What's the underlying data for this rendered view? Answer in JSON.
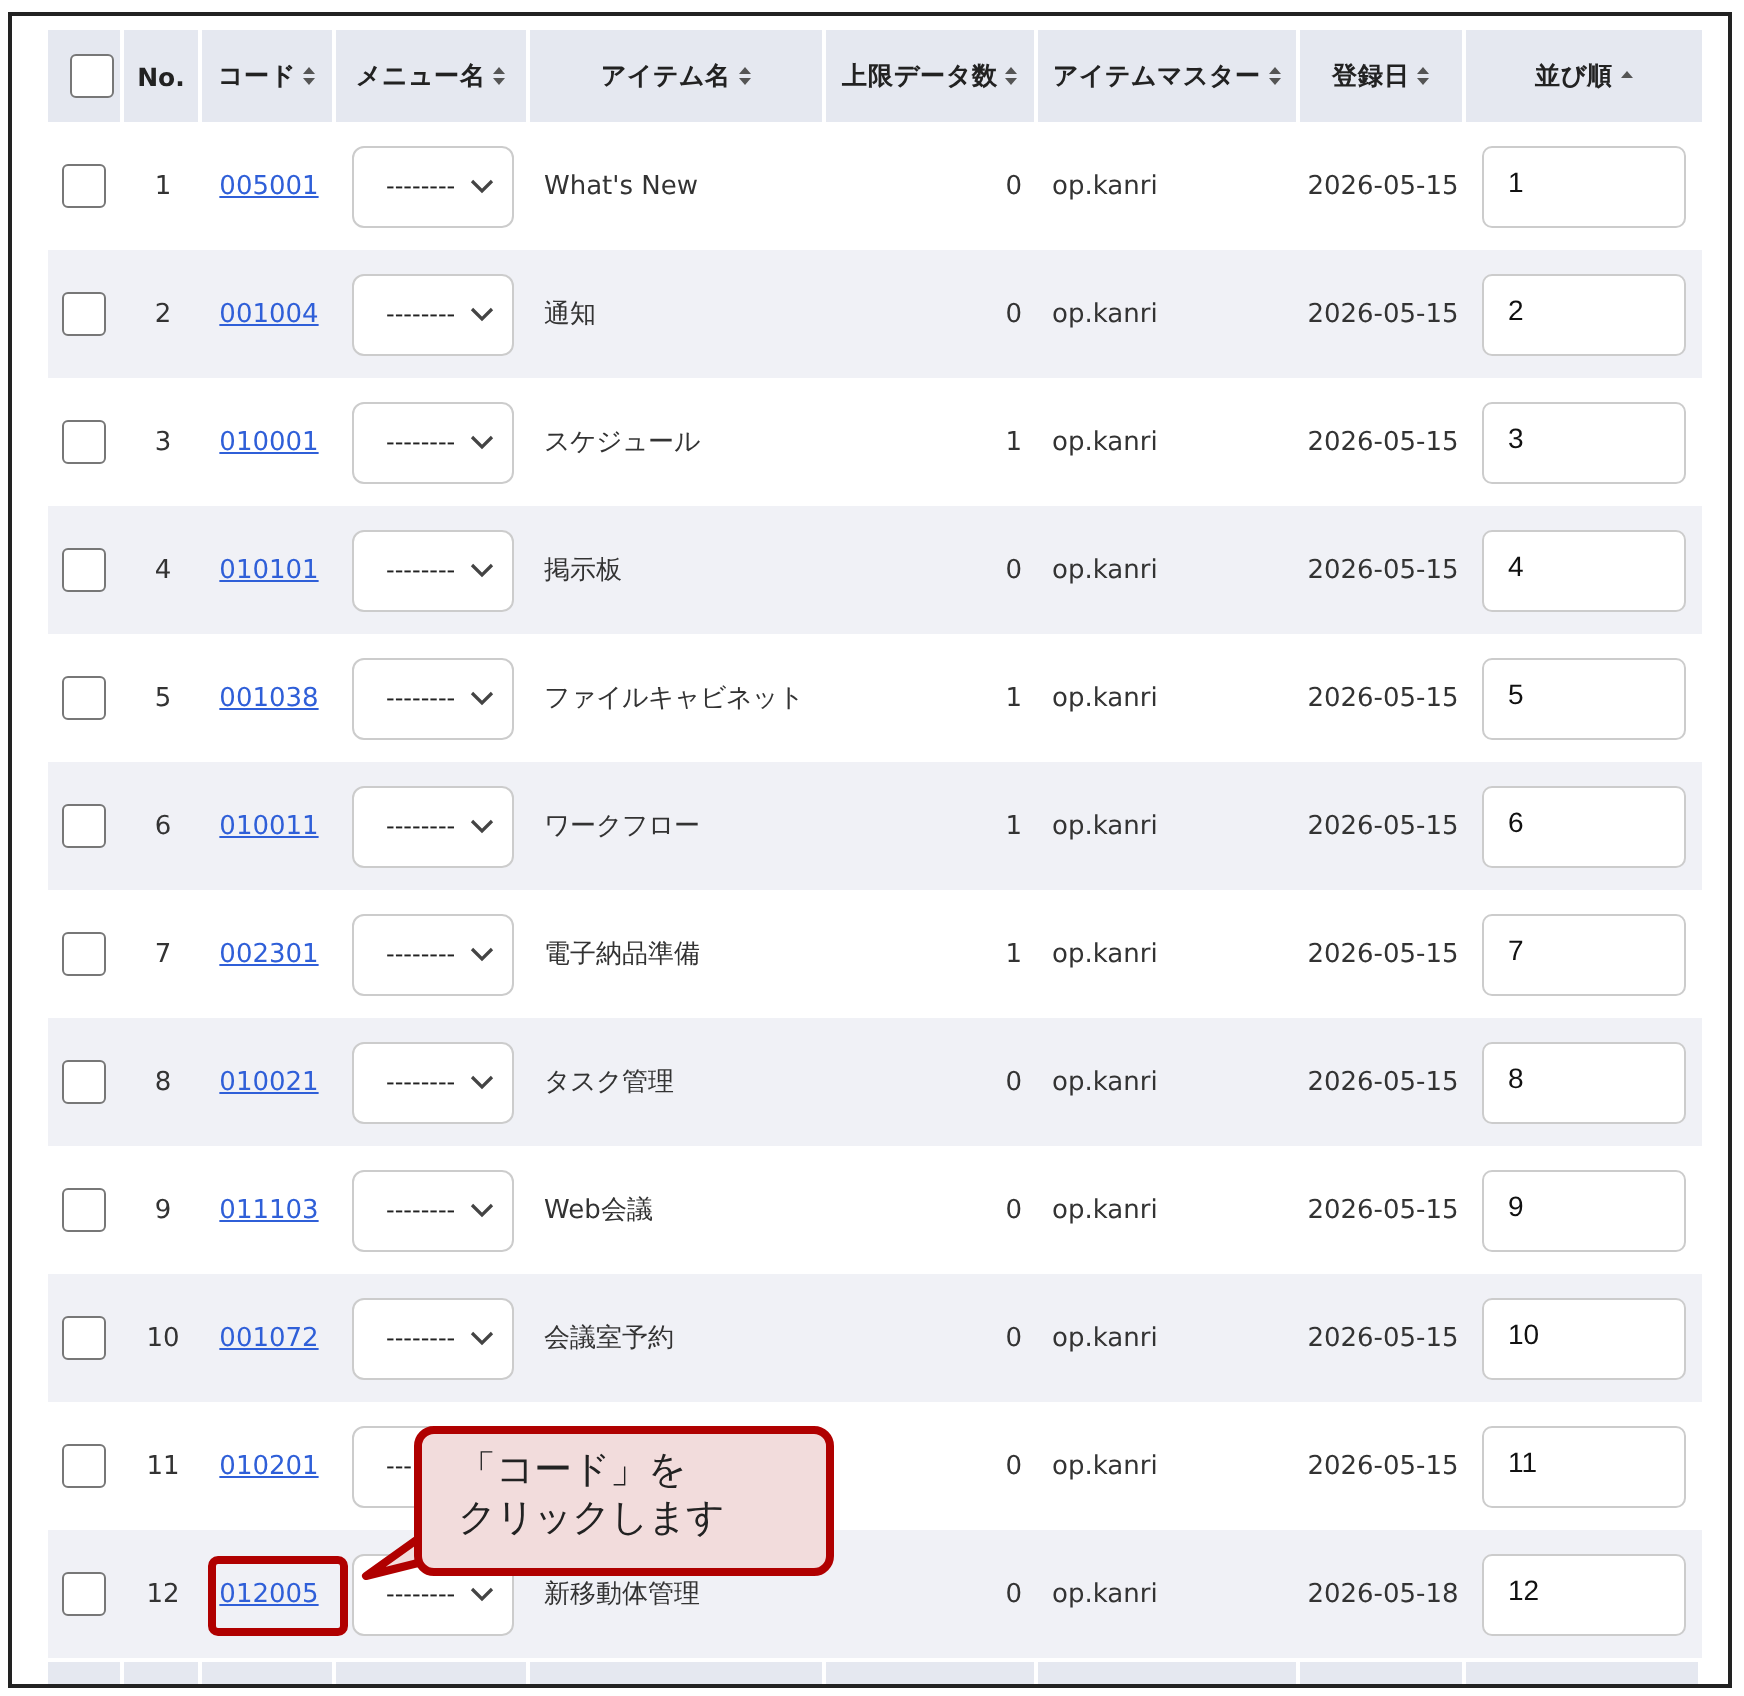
{
  "table": {
    "columns": [
      {
        "kind": "checkbox",
        "checked": false
      },
      {
        "kind": "text",
        "label": "No.",
        "sortable": false
      },
      {
        "kind": "text",
        "label": "コード",
        "sortable": true,
        "sorted": false
      },
      {
        "kind": "text",
        "label": "メニュー名",
        "sortable": true,
        "sorted": false
      },
      {
        "kind": "text",
        "label": "アイテム名",
        "sortable": true,
        "sorted": false
      },
      {
        "kind": "text",
        "label": "上限データ数",
        "sortable": true,
        "sorted": false
      },
      {
        "kind": "text",
        "label": "アイテムマスター",
        "sortable": true,
        "sorted": false
      },
      {
        "kind": "text",
        "label": "登録日",
        "sortable": true,
        "sorted": false
      },
      {
        "kind": "text",
        "label": "並び順",
        "sortable": true,
        "sorted": true
      }
    ],
    "rows": [
      {
        "checked": false,
        "no": "1",
        "code": "005001",
        "menu": "--------",
        "item": "What's New",
        "limit": "0",
        "master": "op.kanri",
        "date": "2026-05-15",
        "order": "1"
      },
      {
        "checked": false,
        "no": "2",
        "code": "001004",
        "menu": "--------",
        "item": "通知",
        "limit": "0",
        "master": "op.kanri",
        "date": "2026-05-15",
        "order": "2"
      },
      {
        "checked": false,
        "no": "3",
        "code": "010001",
        "menu": "--------",
        "item": "スケジュール",
        "limit": "1",
        "master": "op.kanri",
        "date": "2026-05-15",
        "order": "3"
      },
      {
        "checked": false,
        "no": "4",
        "code": "010101",
        "menu": "--------",
        "item": "掲示板",
        "limit": "0",
        "master": "op.kanri",
        "date": "2026-05-15",
        "order": "4"
      },
      {
        "checked": false,
        "no": "5",
        "code": "001038",
        "menu": "--------",
        "item": "ファイルキャビネット",
        "limit": "1",
        "master": "op.kanri",
        "date": "2026-05-15",
        "order": "5"
      },
      {
        "checked": false,
        "no": "6",
        "code": "010011",
        "menu": "--------",
        "item": "ワークフロー",
        "limit": "1",
        "master": "op.kanri",
        "date": "2026-05-15",
        "order": "6"
      },
      {
        "checked": false,
        "no": "7",
        "code": "002301",
        "menu": "--------",
        "item": "電子納品準備",
        "limit": "1",
        "master": "op.kanri",
        "date": "2026-05-15",
        "order": "7"
      },
      {
        "checked": false,
        "no": "8",
        "code": "010021",
        "menu": "--------",
        "item": "タスク管理",
        "limit": "0",
        "master": "op.kanri",
        "date": "2026-05-15",
        "order": "8"
      },
      {
        "checked": false,
        "no": "9",
        "code": "011103",
        "menu": "--------",
        "item": "Web会議",
        "limit": "0",
        "master": "op.kanri",
        "date": "2026-05-15",
        "order": "9"
      },
      {
        "checked": false,
        "no": "10",
        "code": "001072",
        "menu": "--------",
        "item": "会議室予約",
        "limit": "0",
        "master": "op.kanri",
        "date": "2026-05-15",
        "order": "10"
      },
      {
        "checked": false,
        "no": "11",
        "code": "010201",
        "menu": "---",
        "item": "",
        "limit": "0",
        "master": "op.kanri",
        "date": "2026-05-15",
        "order": "11"
      },
      {
        "checked": false,
        "no": "12",
        "code": "012005",
        "menu": "--------",
        "item": "新移動体管理",
        "limit": "0",
        "master": "op.kanri",
        "date": "2026-05-18",
        "order": "12"
      }
    ]
  },
  "callout": {
    "lines": [
      "「コード」を",
      "クリックします"
    ]
  }
}
